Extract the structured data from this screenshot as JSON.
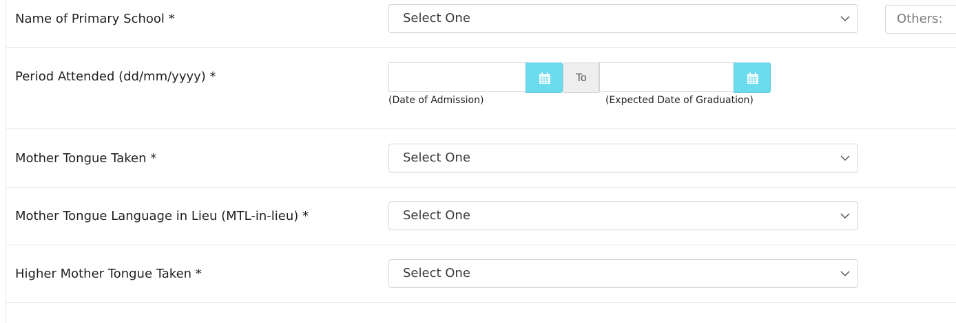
{
  "rows": {
    "primary_school": {
      "label": "Name of Primary School *",
      "select_value": "Select One",
      "others_placeholder": "Others:"
    },
    "period": {
      "label": "Period Attended (dd/mm/yyyy) *",
      "to_label": "To",
      "start_hint": "(Date of Admission)",
      "end_hint": "(Expected Date of Graduation)",
      "icon": "calendar-icon"
    },
    "mother_tongue": {
      "label": "Mother Tongue Taken *",
      "select_value": "Select One"
    },
    "mtl_in_lieu": {
      "label": "Mother Tongue Language in Lieu (MTL-in-lieu) *",
      "select_value": "Select One"
    },
    "higher_mother_tongue": {
      "label": "Higher Mother Tongue Taken *",
      "select_value": "Select One"
    }
  },
  "colors": {
    "accent": "#6bdbee",
    "border": "#d4d4d4"
  }
}
